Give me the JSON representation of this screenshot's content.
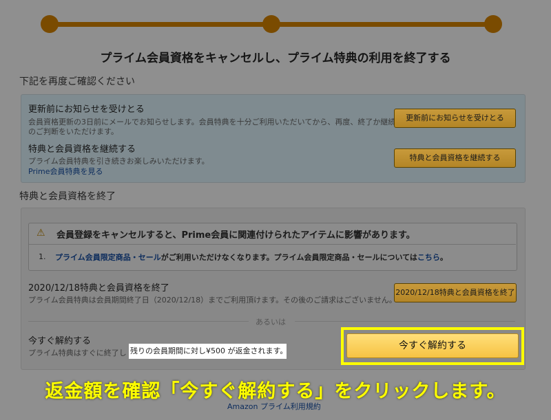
{
  "page_title": "プライム会員資格をキャンセルし、プライム特典の利用を終了する",
  "confirm_heading": "下記を再度ご確認ください",
  "reminder": {
    "title": "更新前にお知らせを受けとる",
    "desc_1": "会員資格更新の3日前にメールでお知らせします。会員特典を十分ご利用いただいてから、再度、終了か継続",
    "desc_2": "のご判断をいただけます。",
    "button": "更新前にお知らせを受けとる"
  },
  "keep": {
    "title": "特典と会員資格を継続する",
    "desc": "プライム会員特典を引き続きお楽しみいただけます。",
    "link": "Prime会員特典を見る",
    "button": "特典と会員資格を継続する"
  },
  "end_heading": "特典と会員資格を終了",
  "warning": {
    "icon": "warning-icon",
    "text": "会員登録をキャンセルすると、Prime会員に関連付けられたアイテムに影響があります。",
    "item_number": "1.",
    "item_link": "プライム会員限定商品・セール",
    "item_text": "がご利用いただけなくなります。プライム会員限定商品・セールについては",
    "item_here_link": "こちら",
    "item_end": "。"
  },
  "end_on_date": {
    "title": "2020/12/18特典と会員資格を終了",
    "desc": "プライム会員特典は会員期間終了日（2020/12/18）までご利用頂けます。その後のご請求はございません。",
    "button": "2020/12/18特典と会員資格を終了"
  },
  "or_text": "あるいは",
  "cancel_now": {
    "title": "今すぐ解約する",
    "desc": "プライム特典はすぐに終了し",
    "refund_note": "残りの会員期間に対し¥500 が返金されます。",
    "button": "今すぐ解約する"
  },
  "caption": "返金額を確認「今すぐ解約する」をクリックします。",
  "footer_link": "Amazon プライム利用規約",
  "colors": {
    "overlay": "#8f8f8f",
    "accent_step": "#7a4b00",
    "highlight": "#ffff00",
    "primary_button": "#f6c343"
  }
}
